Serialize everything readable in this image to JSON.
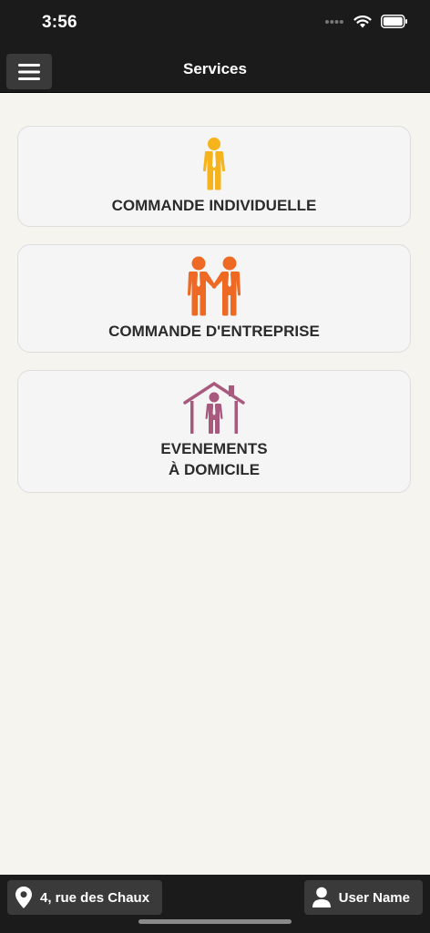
{
  "status_bar": {
    "time": "3:56"
  },
  "nav": {
    "title": "Services"
  },
  "services": [
    {
      "label": "COMMANDE INDIVIDUELLE",
      "icon": "single-person-icon",
      "color": "#f5b31c"
    },
    {
      "label": "COMMANDE D'ENTREPRISE",
      "icon": "two-people-handshake-icon",
      "color": "#ee6a24"
    },
    {
      "label_line1": "EVENEMENTS",
      "label_line2": "À DOMICILE",
      "icon": "house-person-icon",
      "color": "#a85a7e"
    }
  ],
  "bottom_bar": {
    "address": "4, rue des Chaux",
    "user": "User Name"
  },
  "colors": {
    "bar_background": "#1b1b1b",
    "page_background": "#f6f4ef",
    "card_background": "#f5f5f5",
    "button_background": "#3a3a3a"
  }
}
